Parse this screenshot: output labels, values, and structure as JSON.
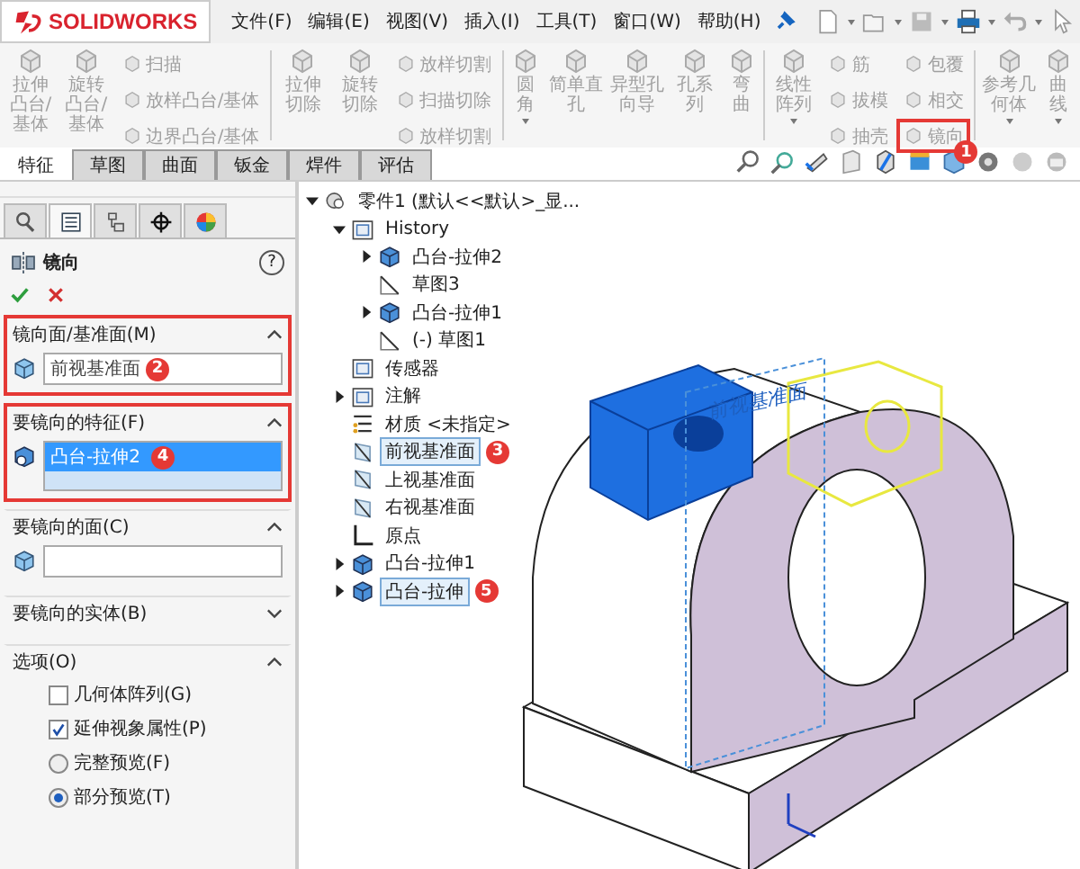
{
  "menu": {
    "logo": "SOLIDWORKS",
    "items": [
      "文件(F)",
      "编辑(E)",
      "视图(V)",
      "插入(I)",
      "工具(T)",
      "窗口(W)",
      "帮助(H)"
    ]
  },
  "ribbon": {
    "groups": [
      {
        "columns": [
          {
            "kind": "large",
            "label": "拉伸凸台/基体",
            "caret": false
          },
          {
            "kind": "large",
            "label": "旋转凸台/基体",
            "caret": false
          },
          {
            "kind": "small",
            "items": [
              {
                "label": "扫描",
                "highlighted": false
              },
              {
                "label": "放样凸台/基体",
                "highlighted": false
              },
              {
                "label": "边界凸台/基体",
                "highlighted": false
              }
            ]
          }
        ]
      },
      {
        "columns": [
          {
            "kind": "large",
            "label": "拉伸切除",
            "caret": false
          },
          {
            "kind": "large",
            "label": "旋转切除",
            "caret": false
          },
          {
            "kind": "small",
            "items": [
              {
                "label": "放样切割",
                "highlighted": false
              },
              {
                "label": "扫描切除",
                "highlighted": false
              },
              {
                "label": "放样切割",
                "highlighted": false
              }
            ]
          }
        ]
      },
      {
        "columns": [
          {
            "kind": "large",
            "label": "圆角",
            "caret": true
          },
          {
            "kind": "large",
            "label": "简单直孔",
            "caret": false
          },
          {
            "kind": "large",
            "label": "异型孔向导",
            "caret": false
          },
          {
            "kind": "large",
            "label": "孔系列",
            "caret": false
          },
          {
            "kind": "large",
            "label": "弯曲",
            "caret": false
          }
        ]
      },
      {
        "columns": [
          {
            "kind": "large",
            "label": "线性阵列",
            "caret": true
          },
          {
            "kind": "small",
            "items": [
              {
                "label": "筋",
                "highlighted": false
              },
              {
                "label": "拔模",
                "highlighted": false
              },
              {
                "label": "抽壳",
                "highlighted": false
              }
            ]
          },
          {
            "kind": "small",
            "items": [
              {
                "label": "包覆",
                "highlighted": false
              },
              {
                "label": "相交",
                "highlighted": false
              },
              {
                "label": "镜向",
                "highlighted": true,
                "badge": "1"
              }
            ]
          }
        ]
      },
      {
        "columns": [
          {
            "kind": "large",
            "label": "参考几何体",
            "caret": true
          },
          {
            "kind": "large",
            "label": "曲线",
            "caret": true
          }
        ]
      }
    ]
  },
  "tabs": [
    {
      "label": "特征",
      "selected": true
    },
    {
      "label": "草图",
      "selected": false
    },
    {
      "label": "曲面",
      "selected": false
    },
    {
      "label": "钣金",
      "selected": false
    },
    {
      "label": "焊件",
      "selected": false
    },
    {
      "label": "评估",
      "selected": false
    }
  ],
  "panel_tabs": [
    {
      "kind": "features",
      "selected": false
    },
    {
      "kind": "properties",
      "selected": true
    },
    {
      "kind": "configurations",
      "selected": false
    },
    {
      "kind": "dimxpert",
      "selected": false
    },
    {
      "kind": "display",
      "selected": false
    }
  ],
  "property_manager": {
    "title": "镜向",
    "help": "?",
    "sections": [
      {
        "title": "镜向面/基准面(M)",
        "expanded": true,
        "highlighted": true,
        "kind": "field",
        "value": "前视基准面",
        "badge": "2"
      },
      {
        "title": "要镜向的特征(F)",
        "expanded": true,
        "highlighted": true,
        "kind": "list",
        "items": [
          {
            "label": "凸台-拉伸2",
            "selected": true,
            "badge": "4"
          }
        ]
      },
      {
        "title": "要镜向的面(C)",
        "expanded": true,
        "highlighted": false,
        "kind": "field"
      },
      {
        "title": "要镜向的实体(B)",
        "expanded": false,
        "highlighted": false
      },
      {
        "title": "选项(O)",
        "expanded": true,
        "highlighted": false,
        "kind": "options",
        "options": [
          {
            "kind": "checkbox",
            "label": "几何体阵列(G)",
            "checked": false
          },
          {
            "kind": "checkbox",
            "label": "延伸视象属性(P)",
            "checked": true
          },
          {
            "kind": "radio",
            "label": "完整预览(F)",
            "selected": false
          },
          {
            "kind": "radio",
            "label": "部分预览(T)",
            "selected": true
          }
        ]
      }
    ]
  },
  "tree": [
    {
      "label": "零件1  (默认<<默认>_显...",
      "kind": "part",
      "expanded": true,
      "selected": false,
      "children": [
        {
          "label": "History",
          "kind": "history",
          "expanded": true,
          "selected": false,
          "children": [
            {
              "label": "凸台-拉伸2",
              "kind": "feature",
              "expanded": false,
              "selected": false
            },
            {
              "label": "草图3",
              "kind": "sketch",
              "selected": false
            },
            {
              "label": "凸台-拉伸1",
              "kind": "feature",
              "expanded": false,
              "selected": false
            },
            {
              "label": "(-) 草图1",
              "kind": "sketch",
              "selected": false
            }
          ]
        },
        {
          "label": "传感器",
          "kind": "sensor",
          "selected": false
        },
        {
          "label": "注解",
          "kind": "annotation",
          "expanded": false,
          "selected": false
        },
        {
          "label": "材质 <未指定>",
          "kind": "material",
          "selected": false
        },
        {
          "label": "前视基准面",
          "kind": "plane",
          "selected": true,
          "badge": "3"
        },
        {
          "label": "上视基准面",
          "kind": "plane",
          "selected": false
        },
        {
          "label": "右视基准面",
          "kind": "plane",
          "selected": false
        },
        {
          "label": "原点",
          "kind": "origin",
          "selected": false
        },
        {
          "label": "凸台-拉伸1",
          "kind": "feature",
          "expanded": false,
          "selected": false
        },
        {
          "label": "凸台-拉伸",
          "kind": "feature",
          "expanded": false,
          "selected": true,
          "badge": "5"
        }
      ]
    }
  ],
  "viewport": {
    "plane_label": "前视基准面"
  }
}
